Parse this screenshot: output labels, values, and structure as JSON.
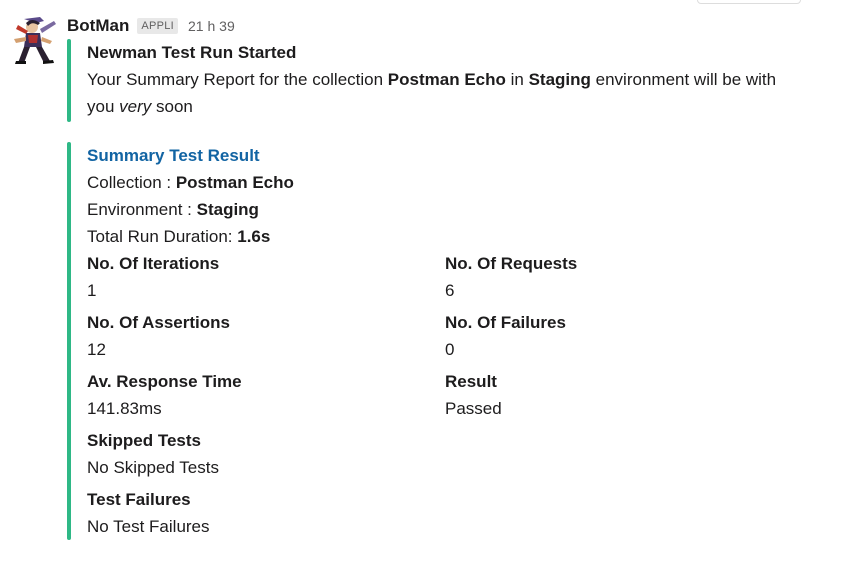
{
  "message": {
    "sender": "BotMan",
    "app_badge": "APPLI",
    "timestamp": "21 h 39",
    "accent_color": "#2eb886",
    "link_color": "#1264a3",
    "avatar_icon": "warrior-avatar-icon"
  },
  "attachment1": {
    "title": "Newman Test Run Started",
    "text_prefix": "Your Summary Report for the collection ",
    "collection": "Postman Echo",
    "text_middle": " in ",
    "environment": "Staging",
    "text_suffix": " environment will be with you ",
    "emphasis": "very",
    "text_end": " soon"
  },
  "attachment2": {
    "title": "Summary Test Result",
    "collection_label": "Collection : ",
    "collection_value": "Postman Echo",
    "environment_label": "Environment : ",
    "environment_value": "Staging",
    "duration_label": "Total Run Duration: ",
    "duration_value": "1.6s",
    "fields": [
      {
        "title": "No. Of Iterations",
        "value": "1"
      },
      {
        "title": "No. Of Requests",
        "value": "6"
      },
      {
        "title": "No. Of Assertions",
        "value": "12"
      },
      {
        "title": "No. Of Failures",
        "value": "0"
      },
      {
        "title": "Av. Response Time",
        "value": "141.83ms"
      },
      {
        "title": "Result",
        "value": "Passed"
      },
      {
        "title": "Skipped Tests",
        "value": "No Skipped Tests"
      }
    ],
    "test_failures_title": "Test Failures",
    "test_failures_value": "No Test Failures"
  }
}
